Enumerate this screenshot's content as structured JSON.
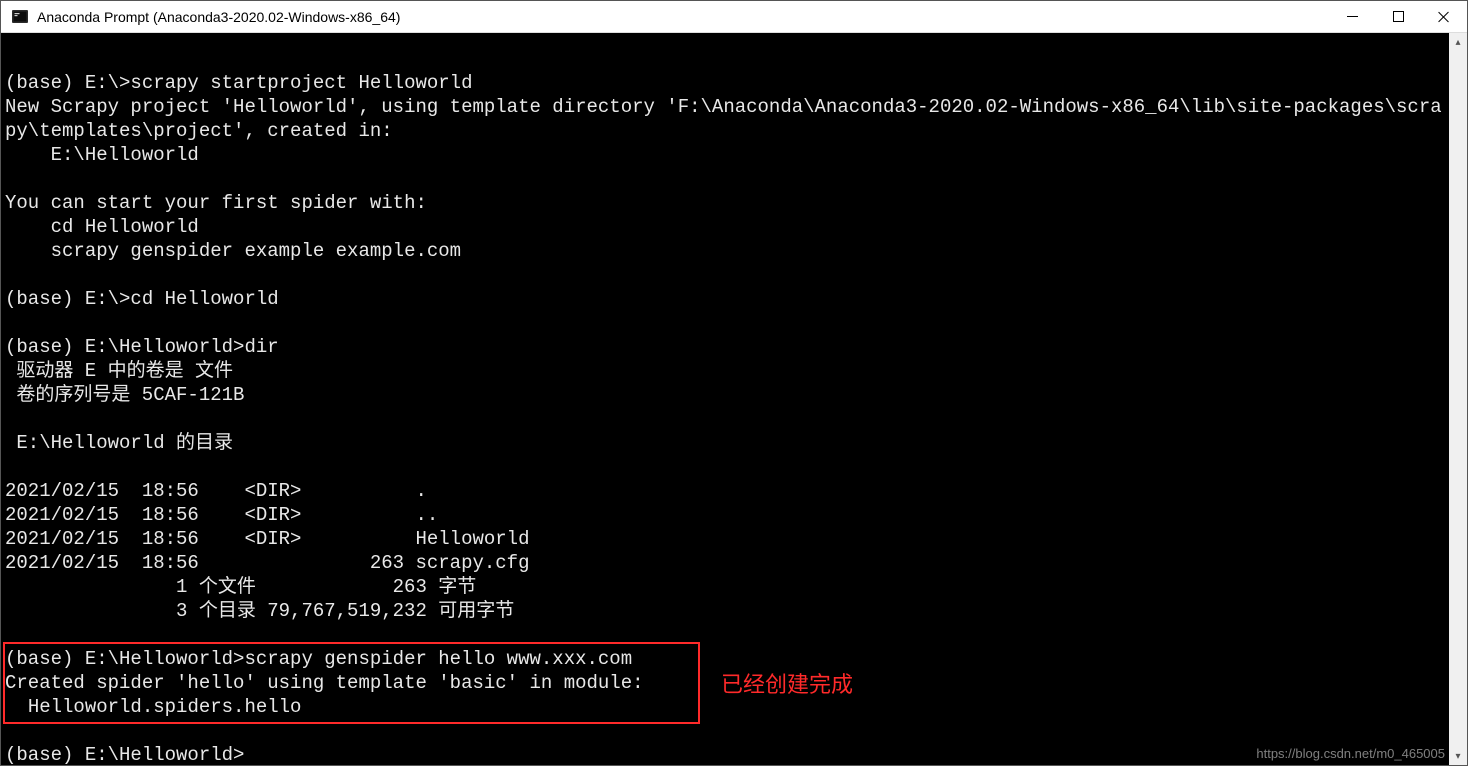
{
  "window": {
    "title": "Anaconda Prompt (Anaconda3-2020.02-Windows-x86_64)"
  },
  "terminal": {
    "lines": [
      "",
      "(base) E:\\>scrapy startproject Helloworld",
      "New Scrapy project 'Helloworld', using template directory 'F:\\Anaconda\\Anaconda3-2020.02-Windows-x86_64\\lib\\site-packages\\scrapy\\templates\\project', created in:",
      "    E:\\Helloworld",
      "",
      "You can start your first spider with:",
      "    cd Helloworld",
      "    scrapy genspider example example.com",
      "",
      "(base) E:\\>cd Helloworld",
      "",
      "(base) E:\\Helloworld>dir",
      " 驱动器 E 中的卷是 文件",
      " 卷的序列号是 5CAF-121B",
      "",
      " E:\\Helloworld 的目录",
      "",
      "2021/02/15  18:56    <DIR>          .",
      "2021/02/15  18:56    <DIR>          ..",
      "2021/02/15  18:56    <DIR>          Helloworld",
      "2021/02/15  18:56               263 scrapy.cfg",
      "               1 个文件            263 字节",
      "               3 个目录 79,767,519,232 可用字节",
      "",
      "(base) E:\\Helloworld>scrapy genspider hello www.xxx.com",
      "Created spider 'hello' using template 'basic' in module:",
      "  Helloworld.spiders.hello",
      "",
      "(base) E:\\Helloworld>"
    ]
  },
  "annotation": {
    "label": "已经创建完成"
  },
  "watermark": {
    "text": "https://blog.csdn.net/m0_465005"
  }
}
